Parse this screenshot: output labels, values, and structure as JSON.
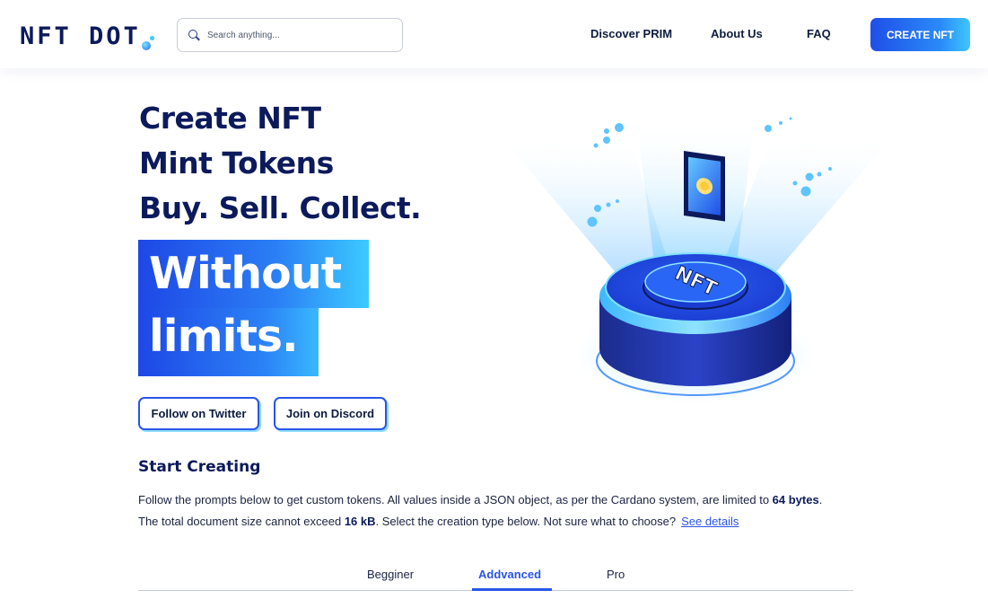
{
  "header": {
    "logo_text": "NFT DOT",
    "search_placeholder": "Search anything...",
    "nav": {
      "discover": "Discover PRIM",
      "about": "About Us",
      "faq": "FAQ"
    },
    "cta_label": "CREATE NFT"
  },
  "hero": {
    "line1": "Create NFT",
    "line2": "Mint Tokens",
    "line3": "Buy. Sell. Collect.",
    "highlight_line1": "Without",
    "highlight_line2": "limits.",
    "twitter_button": "Follow on Twitter",
    "discord_button": "Join on Discord",
    "illustration_label": "NFT"
  },
  "start": {
    "title": "Start Creating",
    "p1_text": "Follow the prompts below to get custom tokens. All values inside a JSON object, as per the Cardano system, are limited to ",
    "p1_bold": "64 bytes",
    "p1_end": ".",
    "p2_text": "The total document size cannot exceed ",
    "p2_bold": "16 kB",
    "p2_mid": ".  Select the creation type below. Not sure what to choose?",
    "p2_link": "See details"
  },
  "tabs": {
    "items": [
      "Begginer",
      "Addvanced",
      "Pro"
    ],
    "active": "Addvanced"
  },
  "colors": {
    "brand_navy": "#0c1a5c",
    "accent_blue": "#2a55e8",
    "accent_cyan": "#3fc6ff"
  }
}
